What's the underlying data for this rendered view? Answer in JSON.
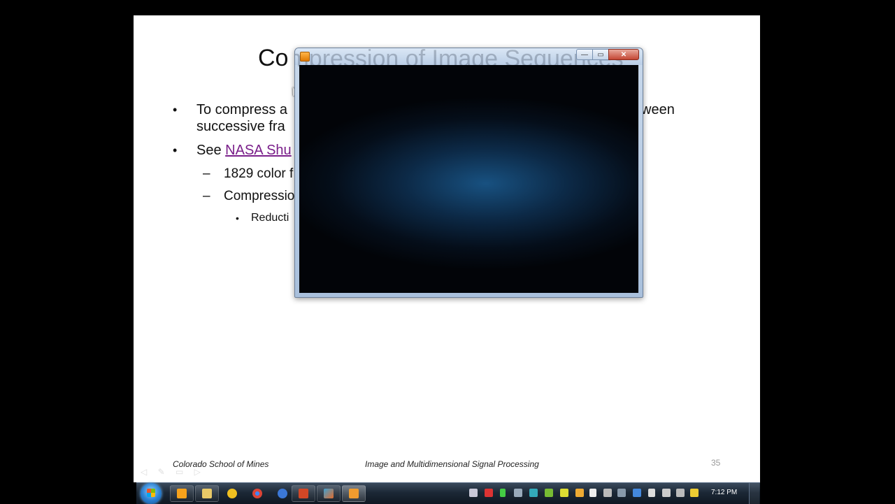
{
  "slide": {
    "title_left": "Co",
    "bullets": [
      {
        "text": "To compress a",
        "cont": "successive fra",
        "tail": "ween"
      },
      {
        "prefix": "See ",
        "link": "NASA Shu"
      }
    ],
    "sub_bullets": [
      "1829 color f",
      "Compressio"
    ],
    "subsub_bullets": [
      "Reducti"
    ],
    "footer_left": "Colorado School of Mines",
    "footer_center": "Image and Multidimensional Signal Processing",
    "page_number": "35"
  },
  "media_window": {
    "title_ghost": "Compression of Image Sequences",
    "buttons": {
      "minimize": "—",
      "maximize": "▭",
      "close": "✕"
    }
  },
  "taskbar": {
    "clock": "7:12 PM",
    "buttons": [
      "outlook-icon",
      "explorer-icon",
      "app-icon",
      "chrome-icon",
      "media-icon",
      "powerpoint-icon",
      "matlab-icon",
      "media-player-icon"
    ],
    "colors": {
      "outlook": "#f7a21b",
      "explorer": "#e8c968",
      "app": "#f0c020",
      "chrome": "#db4437",
      "media": "#3b78d8",
      "powerpoint": "#d24726",
      "matlab": "#e06a2c",
      "player": "#ef9b2f"
    }
  }
}
